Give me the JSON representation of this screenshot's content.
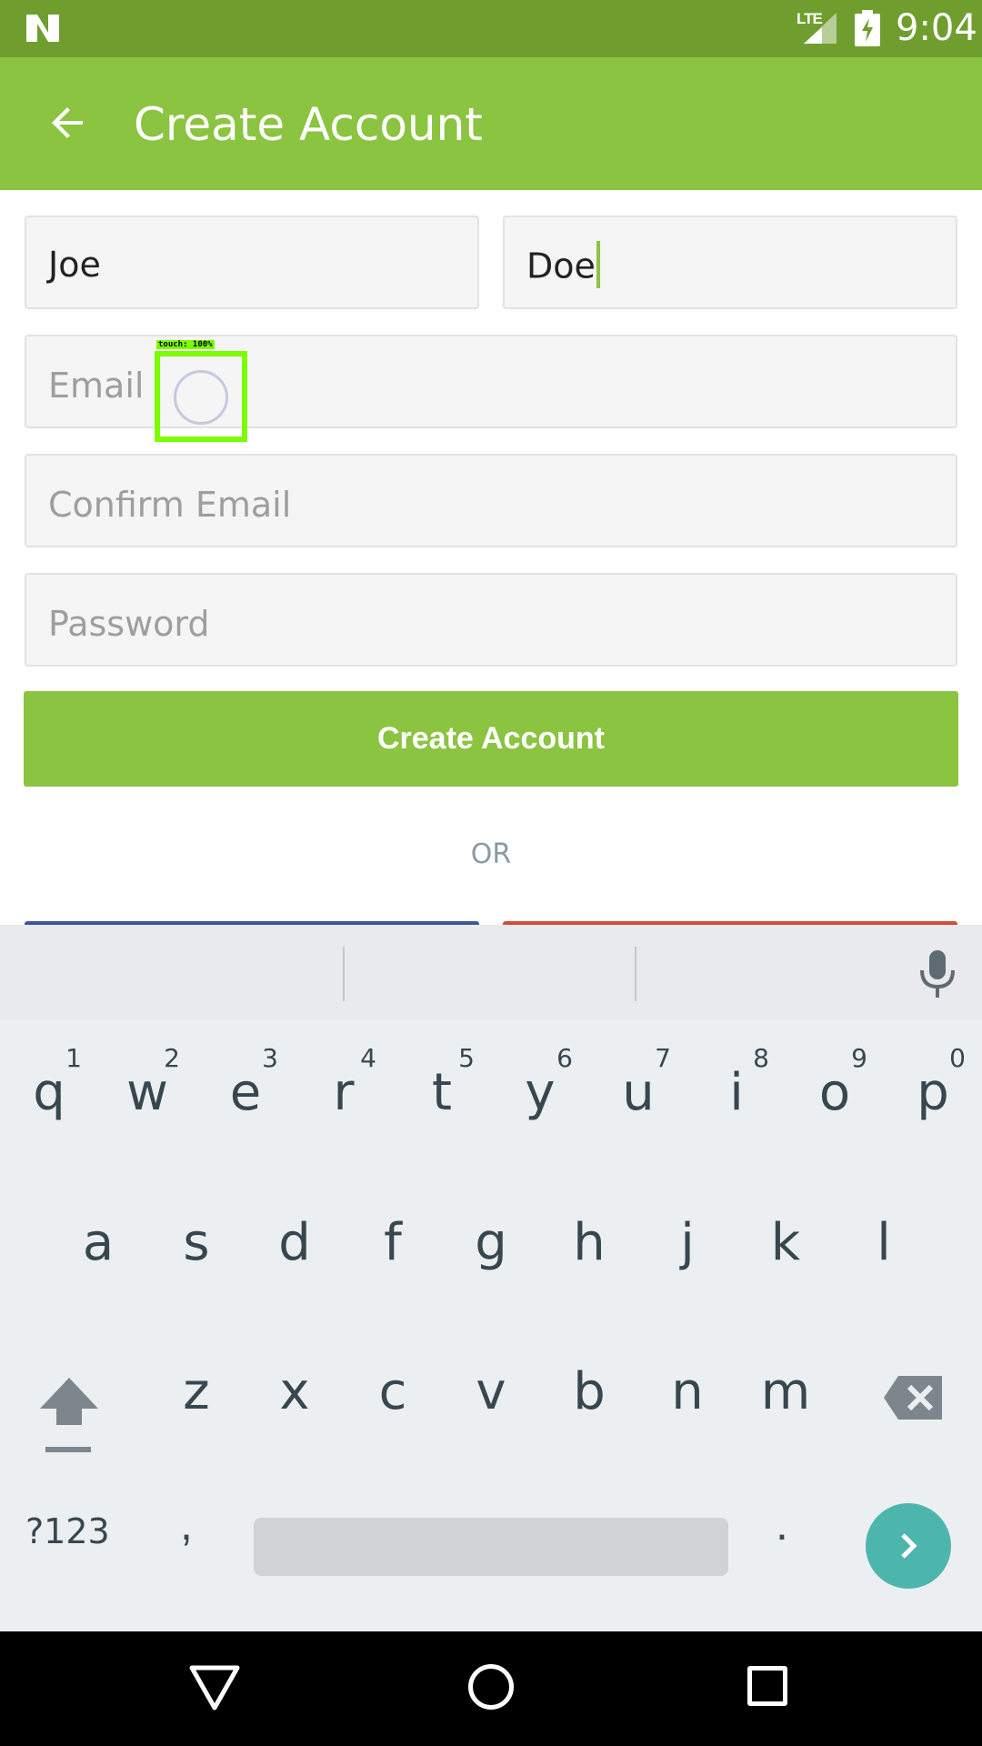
{
  "status_bar": {
    "time": "9:04",
    "network": "LTE"
  },
  "app_bar": {
    "title": "Create Account"
  },
  "form": {
    "first_name": {
      "value": "Joe"
    },
    "last_name": {
      "value": "Doe"
    },
    "email": {
      "placeholder": "Email"
    },
    "confirm_email": {
      "placeholder": "Confirm Email"
    },
    "password": {
      "placeholder": "Password"
    },
    "submit_label": "Create Account",
    "or_label": "OR"
  },
  "touch_indicator": {
    "label": "touch: 100%"
  },
  "keyboard": {
    "row1": [
      {
        "letter": "q",
        "num": "1"
      },
      {
        "letter": "w",
        "num": "2"
      },
      {
        "letter": "e",
        "num": "3"
      },
      {
        "letter": "r",
        "num": "4"
      },
      {
        "letter": "t",
        "num": "5"
      },
      {
        "letter": "y",
        "num": "6"
      },
      {
        "letter": "u",
        "num": "7"
      },
      {
        "letter": "i",
        "num": "8"
      },
      {
        "letter": "o",
        "num": "9"
      },
      {
        "letter": "p",
        "num": "0"
      }
    ],
    "row2": [
      "a",
      "s",
      "d",
      "f",
      "g",
      "h",
      "j",
      "k",
      "l"
    ],
    "row3": [
      "z",
      "x",
      "c",
      "v",
      "b",
      "n",
      "m"
    ],
    "symbols_label": "?123",
    "comma": ",",
    "period": "."
  },
  "colors": {
    "status_bar": "#6f9e2f",
    "app_bar": "#8bc441",
    "accent": "#8bc441",
    "facebook": "#3b5998",
    "google": "#d9493a",
    "go_key": "#4db6ac"
  }
}
